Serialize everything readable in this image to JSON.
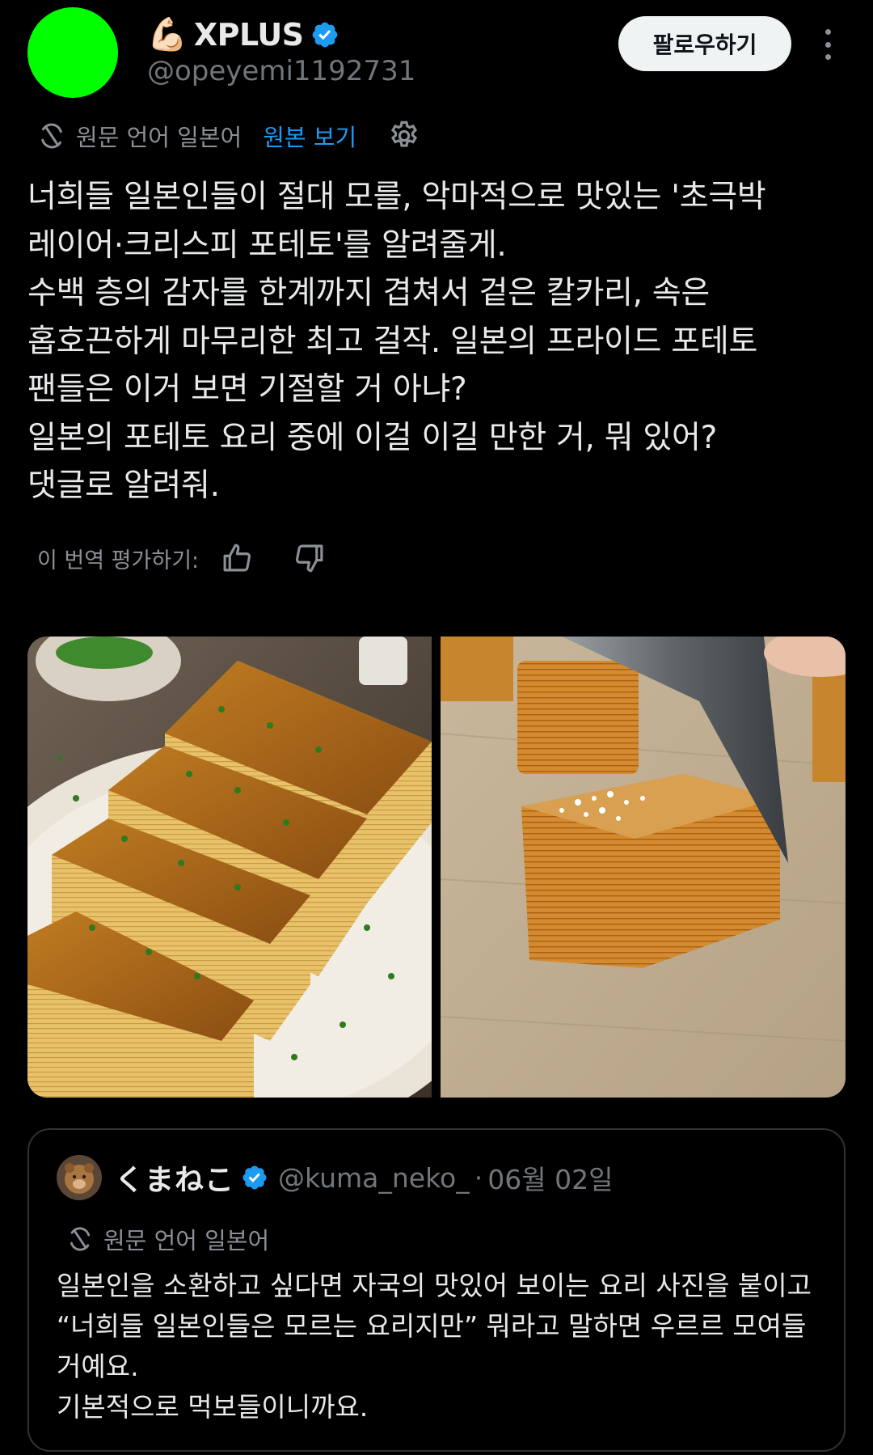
{
  "post": {
    "author": {
      "emoji": "💪🏻",
      "display_name": "XPLUS",
      "handle": "@opeyemi1192731",
      "avatar_color": "#00ff00"
    },
    "follow_label": "팔로우하기",
    "translation": {
      "source_label": "원문 언어 일본어",
      "show_original_label": "원본 보기"
    },
    "text_lines": [
      "너희들 일본인들이 절대 모를, 악마적으로 맛있는 '초극박",
      "레이어·크리스피 포테토'를 알려줄게.",
      "수백 층의 감자를 한계까지 겹쳐서 겉은 칼카리, 속은",
      "홉호끈하게 마무리한 최고 걸작. 일본의 프라이드 포테토",
      "팬들은 이거 보면 기절할 거 아냐?",
      "일본의 포테토 요리 중에 이걸 이길 만한 거, 뭐 있어?",
      "댓글로 알려줘."
    ],
    "rate_label": "이 번역 평가하기:"
  },
  "quote": {
    "display_name": "くまねこ",
    "handle": "@kuma_neko_",
    "separator": "·",
    "date": "06월 02일",
    "translation_label": "원문 언어 일본어",
    "text_lines": [
      "일본인을 소환하고 싶다면 자국의 맛있어 보이는 요리 사진을 붙이고",
      "“너희들 일본인들은 모르는 요리지만” 뭐라고 말하면 우르르 모여들",
      "거예요.",
      "기본적으로 먹보들이니까요."
    ]
  },
  "colors": {
    "background": "#000000",
    "text_primary": "#e7e9ea",
    "text_secondary": "#71767b",
    "link": "#1d9bf0",
    "verified": "#1d9bf0",
    "border": "#2f3336"
  },
  "icons": [
    "verified-badge-icon",
    "more-vertical-icon",
    "translate-icon",
    "settings-gear-icon",
    "thumbs-up-icon",
    "thumbs-down-icon"
  ]
}
